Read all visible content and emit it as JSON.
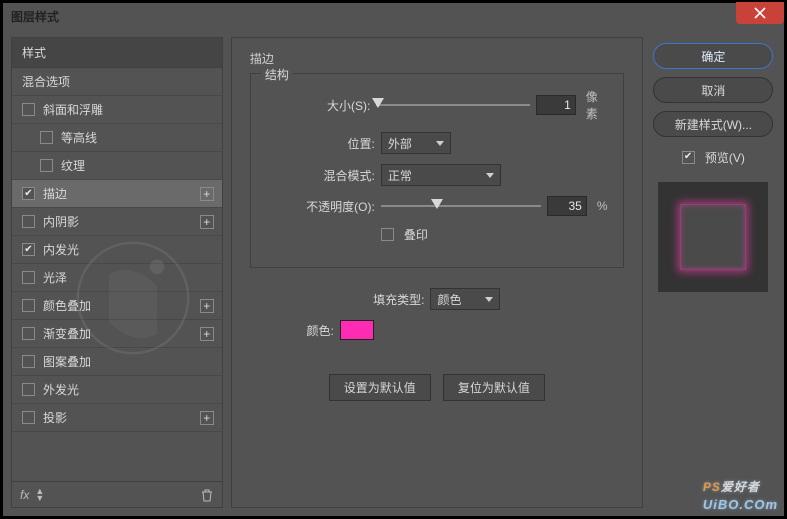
{
  "title": "图层样式",
  "buttons": {
    "ok": "确定",
    "cancel": "取消",
    "new_style": "新建样式(W)...",
    "set_default": "设置为默认值",
    "reset_default": "复位为默认值"
  },
  "preview": {
    "label": "预览(V)",
    "checked": true
  },
  "left": {
    "styles_header": "样式",
    "blend_options": "混合选项",
    "items": [
      {
        "label": "斜面和浮雕",
        "checked": false,
        "sub": false,
        "plus": false
      },
      {
        "label": "等高线",
        "checked": false,
        "sub": true,
        "plus": false
      },
      {
        "label": "纹理",
        "checked": false,
        "sub": true,
        "plus": false
      },
      {
        "label": "描边",
        "checked": true,
        "sub": false,
        "plus": true,
        "selected": true
      },
      {
        "label": "内阴影",
        "checked": false,
        "sub": false,
        "plus": true
      },
      {
        "label": "内发光",
        "checked": true,
        "sub": false,
        "plus": false
      },
      {
        "label": "光泽",
        "checked": false,
        "sub": false,
        "plus": false
      },
      {
        "label": "颜色叠加",
        "checked": false,
        "sub": false,
        "plus": true
      },
      {
        "label": "渐变叠加",
        "checked": false,
        "sub": false,
        "plus": true
      },
      {
        "label": "图案叠加",
        "checked": false,
        "sub": false,
        "plus": false
      },
      {
        "label": "外发光",
        "checked": false,
        "sub": false,
        "plus": false
      },
      {
        "label": "投影",
        "checked": false,
        "sub": false,
        "plus": true
      }
    ],
    "fx": "fx"
  },
  "center": {
    "section": "描边",
    "group1": "结构",
    "size_label": "大小(S):",
    "size_value": "1",
    "size_unit": "像素",
    "position_label": "位置:",
    "position_value": "外部",
    "blend_label": "混合模式:",
    "blend_value": "正常",
    "opacity_label": "不透明度(O):",
    "opacity_value": "35",
    "opacity_unit": "%",
    "overprint_label": "叠印",
    "fill_type_label": "填充类型:",
    "fill_type_value": "颜色",
    "color_label": "颜色:",
    "color_hex": "#ff2bb3"
  },
  "watermark": {
    "ps": "PS",
    "rest": "爱好者",
    "url": "UiBO.COm"
  }
}
